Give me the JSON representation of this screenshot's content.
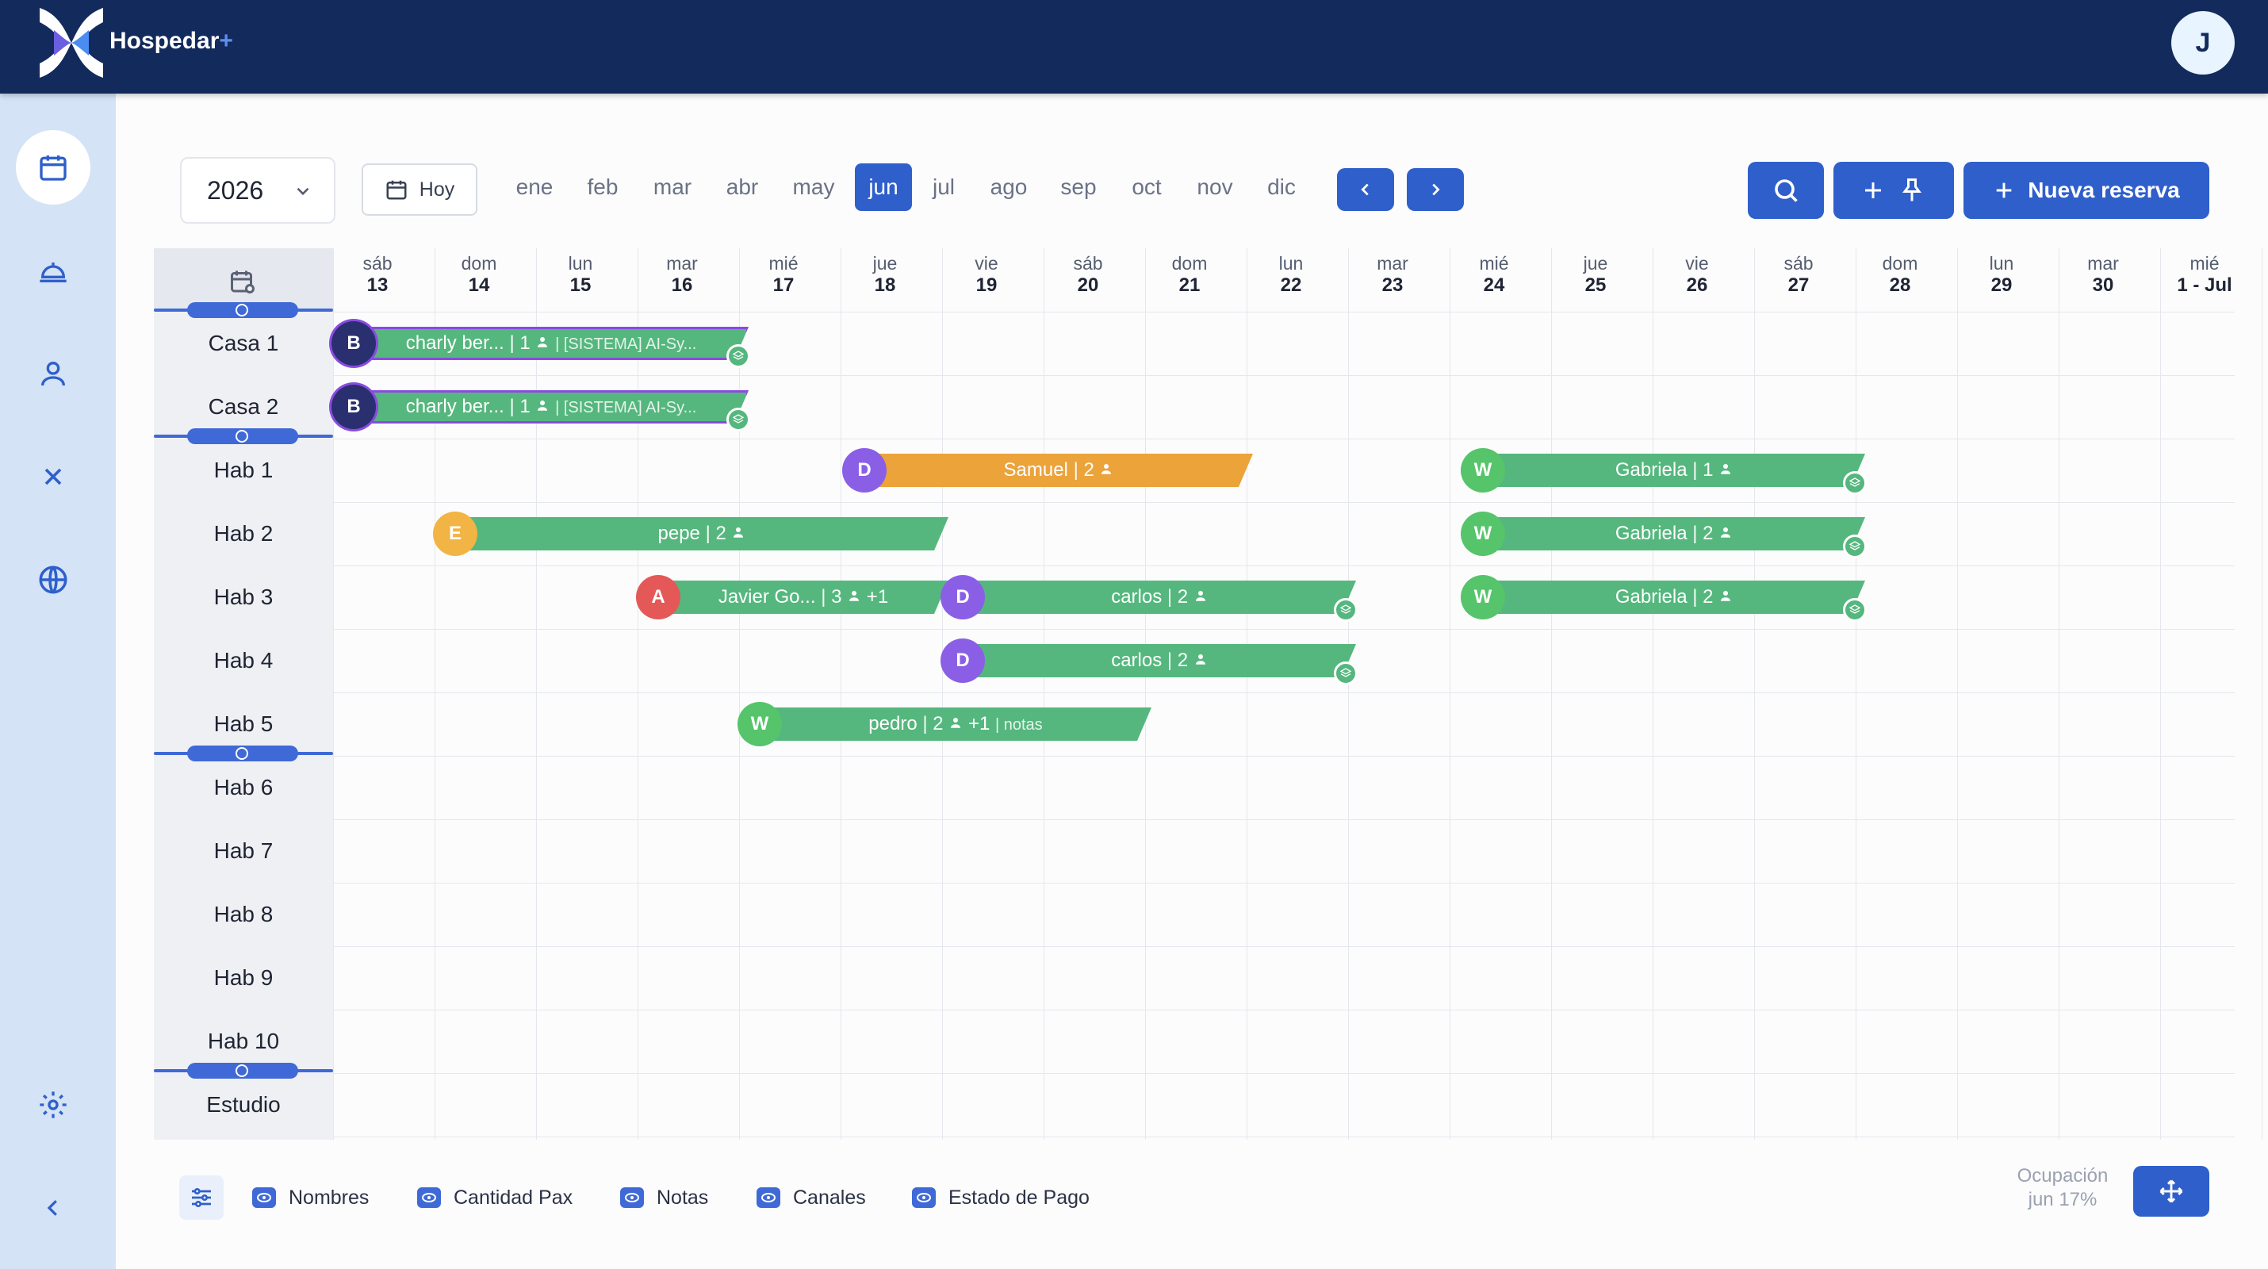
{
  "app": {
    "name": "Hospedar",
    "name_plus": "+",
    "user_initial": "J"
  },
  "toolbar": {
    "year": "2026",
    "today": "Hoy",
    "new_booking": "Nueva reserva",
    "months": [
      "ene",
      "feb",
      "mar",
      "abr",
      "may",
      "jun",
      "jul",
      "ago",
      "sep",
      "oct",
      "nov",
      "dic"
    ],
    "active_month": "jun"
  },
  "days": [
    {
      "dow": "sáb",
      "d": "13"
    },
    {
      "dow": "dom",
      "d": "14"
    },
    {
      "dow": "lun",
      "d": "15"
    },
    {
      "dow": "mar",
      "d": "16"
    },
    {
      "dow": "mié",
      "d": "17"
    },
    {
      "dow": "jue",
      "d": "18"
    },
    {
      "dow": "vie",
      "d": "19"
    },
    {
      "dow": "sáb",
      "d": "20"
    },
    {
      "dow": "dom",
      "d": "21"
    },
    {
      "dow": "lun",
      "d": "22"
    },
    {
      "dow": "mar",
      "d": "23"
    },
    {
      "dow": "mié",
      "d": "24"
    },
    {
      "dow": "jue",
      "d": "25"
    },
    {
      "dow": "vie",
      "d": "26"
    },
    {
      "dow": "sáb",
      "d": "27"
    },
    {
      "dow": "dom",
      "d": "28"
    },
    {
      "dow": "lun",
      "d": "29"
    },
    {
      "dow": "mar",
      "d": "30"
    },
    {
      "dow": "mié",
      "d": "1 - Jul"
    }
  ],
  "rooms": [
    "Casa 1",
    "Casa 2",
    "Hab 1",
    "Hab 2",
    "Hab 3",
    "Hab 4",
    "Hab 5",
    "Hab 6",
    "Hab 7",
    "Hab 8",
    "Hab 9",
    "Hab 10",
    "Estudio"
  ],
  "bookings": [
    {
      "room": 0,
      "initial": "B",
      "name": "charly ber...",
      "pax": "1",
      "extra": "[SISTEMA] AI-Sy...",
      "color": "#55b77e",
      "avatar": "#2a2f70",
      "outline": true,
      "chip": true
    },
    {
      "room": 1,
      "initial": "B",
      "name": "charly ber...",
      "pax": "1",
      "extra": "[SISTEMA] AI-Sy...",
      "color": "#55b77e",
      "avatar": "#2a2f70",
      "outline": true,
      "chip": true
    },
    {
      "room": 2,
      "initial": "D",
      "name": "Samuel",
      "pax": "2",
      "color": "#eba33a",
      "avatar": "#8a5fe6"
    },
    {
      "room": 2,
      "initial": "W",
      "name": "Gabriela",
      "pax": "1",
      "color": "#55b77e",
      "avatar": "#55c46a",
      "chip": true
    },
    {
      "room": 3,
      "initial": "E",
      "name": "pepe",
      "pax": "2",
      "color": "#55b77e",
      "avatar": "#f2b445"
    },
    {
      "room": 3,
      "initial": "W",
      "name": "Gabriela",
      "pax": "2",
      "color": "#55b77e",
      "avatar": "#55c46a",
      "chip": true
    },
    {
      "room": 4,
      "initial": "A",
      "name": "Javier Go...",
      "pax": "3",
      "plus": "+1",
      "color": "#55b77e",
      "avatar": "#e55858"
    },
    {
      "room": 4,
      "initial": "D",
      "name": "carlos",
      "pax": "2",
      "color": "#55b77e",
      "avatar": "#8a5fe6",
      "chip": true
    },
    {
      "room": 4,
      "initial": "W",
      "name": "Gabriela",
      "pax": "2",
      "color": "#55b77e",
      "avatar": "#55c46a",
      "chip": true
    },
    {
      "room": 5,
      "initial": "D",
      "name": "carlos",
      "pax": "2",
      "color": "#55b77e",
      "avatar": "#8a5fe6",
      "chip": true
    },
    {
      "room": 6,
      "initial": "W",
      "name": "pedro",
      "pax": "2",
      "plus": "+1",
      "notes": "notas",
      "color": "#55b77e",
      "avatar": "#55c46a"
    }
  ],
  "legend": {
    "names": "Nombres",
    "pax": "Cantidad Pax",
    "notes": "Notas",
    "channels": "Canales",
    "payment": "Estado de Pago"
  },
  "occupancy": {
    "label": "Ocupación",
    "value": "jun 17%"
  }
}
